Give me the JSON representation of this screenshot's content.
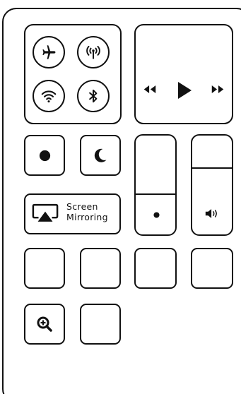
{
  "connectivity": {
    "airplane": {
      "icon": "airplane-icon"
    },
    "cellular": {
      "icon": "cellular-data-icon"
    },
    "wifi": {
      "icon": "wifi-icon"
    },
    "bluetooth": {
      "icon": "bluetooth-icon"
    }
  },
  "media": {
    "rewind_icon": "rewind-icon",
    "play_icon": "play-icon",
    "forward_icon": "fast-forward-icon"
  },
  "toggles": {
    "record_icon": "record-icon",
    "do_not_disturb_icon": "moon-icon"
  },
  "screen_mirroring": {
    "icon": "airplay-icon",
    "label_line1": "Screen",
    "label_line2": "Mirroring"
  },
  "sliders": {
    "brightness": {
      "icon": "brightness-dot-icon",
      "level": 0.3
    },
    "volume": {
      "icon": "speaker-icon",
      "level": 0.7
    }
  },
  "magnifier": {
    "icon": "zoom-in-icon"
  },
  "colors": {
    "stroke": "#111111",
    "background": "#ffffff"
  }
}
